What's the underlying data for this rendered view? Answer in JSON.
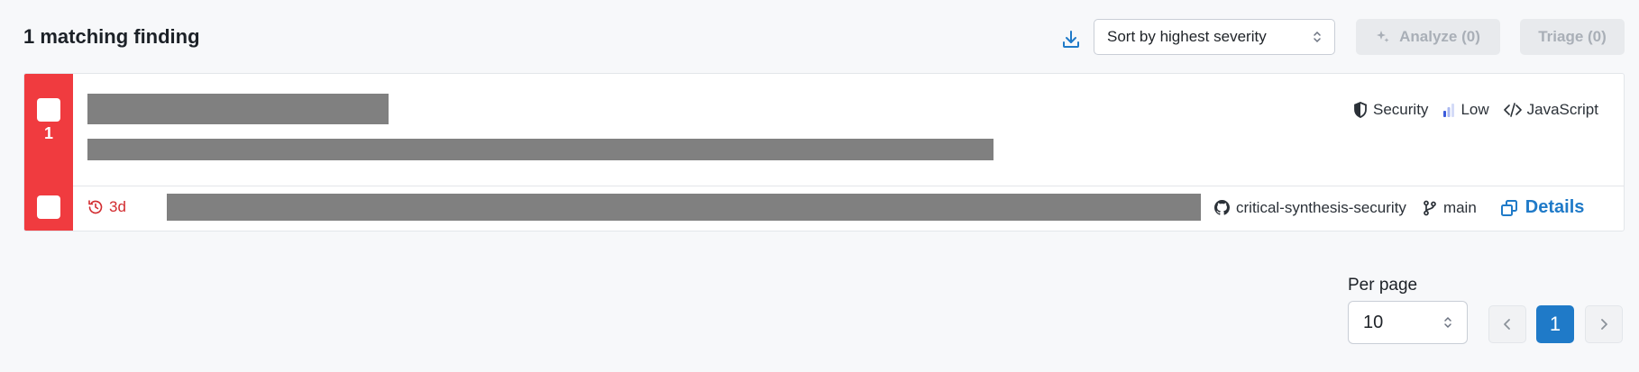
{
  "header": {
    "title": "1 matching finding",
    "sort_value": "Sort by highest severity",
    "analyze_label": "Analyze (0)",
    "triage_label": "Triage (0)"
  },
  "finding": {
    "index": "1",
    "category": "Security",
    "severity": "Low",
    "language": "JavaScript",
    "age": "3d",
    "repository": "critical-synthesis-security",
    "branch": "main",
    "details_label": "Details"
  },
  "pagination": {
    "per_page_label": "Per page",
    "per_page_value": "10",
    "current_page": "1"
  },
  "colors": {
    "accent": "#1f7ac8",
    "critical": "#f03b3f",
    "age_text": "#d22b2f"
  },
  "icons": [
    "download-icon",
    "sort-chevron-icon",
    "sparkle-icon",
    "shield-icon",
    "severity-bars-icon",
    "code-icon",
    "history-icon",
    "github-icon",
    "branch-icon",
    "details-icon",
    "chevron-left-icon",
    "chevron-right-icon"
  ]
}
